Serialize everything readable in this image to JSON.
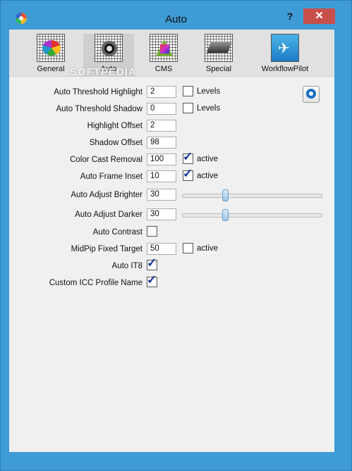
{
  "window": {
    "title": "Auto",
    "help_label": "?",
    "close_label": "✕"
  },
  "tabs": [
    {
      "label": "General",
      "icon": "color-wheel-icon"
    },
    {
      "label": "Auto",
      "icon": "aperture-icon",
      "active": true
    },
    {
      "label": "CMS",
      "icon": "color-gamut-icon"
    },
    {
      "label": "Special",
      "icon": "scanner-icon"
    },
    {
      "label": "WorkflowPilot",
      "icon": "airplane-icon"
    }
  ],
  "watermark": "SOFTPEDIA",
  "settings": {
    "threshold_highlight": {
      "label": "Auto Threshold Highlight",
      "value": "2",
      "check_label": "Levels",
      "checked": false
    },
    "threshold_shadow": {
      "label": "Auto Threshold Shadow",
      "value": "0",
      "check_label": "Levels",
      "checked": false
    },
    "highlight_offset": {
      "label": "Highlight Offset",
      "value": "2"
    },
    "shadow_offset": {
      "label": "Shadow Offset",
      "value": "98"
    },
    "color_cast": {
      "label": "Color Cast Removal",
      "value": "100",
      "check_label": "active",
      "checked": true
    },
    "frame_inset": {
      "label": "Auto Frame Inset",
      "value": "10",
      "check_label": "active",
      "checked": true
    },
    "adjust_brighter": {
      "label": "Auto Adjust Brighter",
      "value": "30",
      "slider_fraction": 0.3
    },
    "adjust_darker": {
      "label": "Auto Adjust Darker",
      "value": "30",
      "slider_fraction": 0.3
    },
    "auto_contrast": {
      "label": "Auto Contrast",
      "checked": false
    },
    "midpip_target": {
      "label": "MidPip Fixed Target",
      "value": "50",
      "check_label": "active",
      "checked": false
    },
    "auto_it8": {
      "label": "Auto IT8",
      "checked": true
    },
    "custom_icc": {
      "label": "Custom ICC Profile Name",
      "checked": true
    }
  }
}
